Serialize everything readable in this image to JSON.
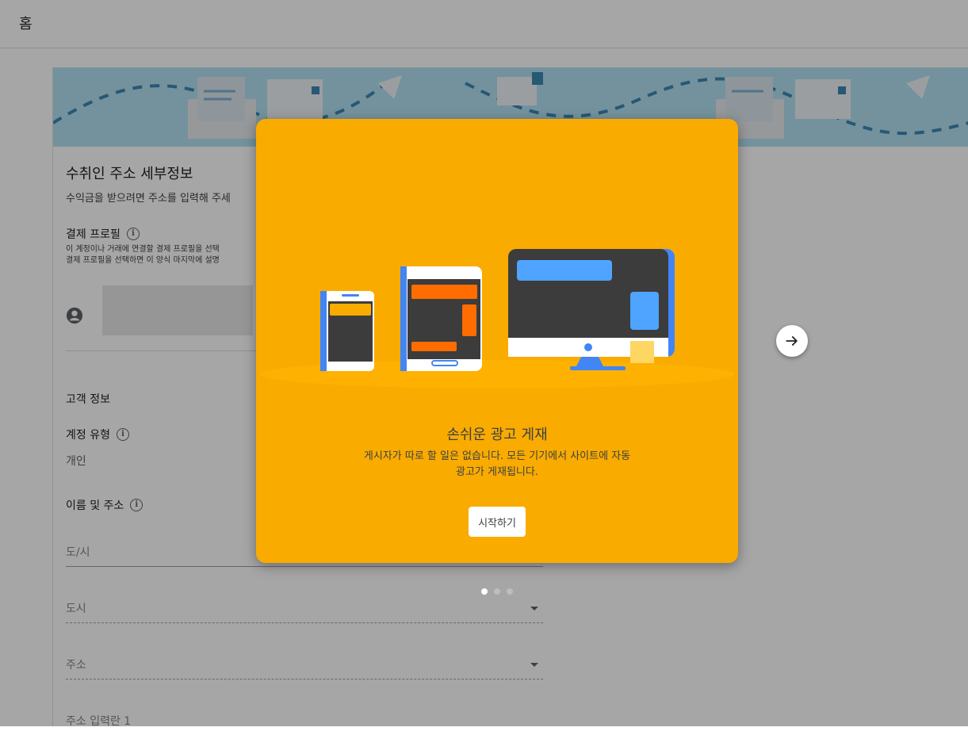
{
  "header": {
    "title": "홈"
  },
  "form": {
    "title": "수취인 주소 세부정보",
    "subtitle": "수익금을 받으려면 주소를 입력해 주세",
    "payment_profile": {
      "label": "결제 프로필",
      "desc_line1": "이 계정이나 거래에 연결할 결제 프로필을 선택",
      "desc_line2": "결제 프로필을 선택하면 이 양식 마지막에 설명"
    },
    "customer_info": {
      "heading": "고객 정보",
      "account_type_label": "계정 유형",
      "account_type_value": "개인",
      "name_address_label": "이름 및 주소"
    },
    "fields": {
      "province": "도/시",
      "city": "도시",
      "address": "주소",
      "address_line1": "주소 입력란 1"
    }
  },
  "modal": {
    "title": "손쉬운 광고 게재",
    "desc_line1": "게시자가 따로 할 일은 없습니다. 모든 기기에서 사이트에 자동",
    "desc_line2": "광고가 게재됩니다.",
    "start_button": "시작하기",
    "bg_color": "#f9ab00"
  },
  "carousel": {
    "total": 3,
    "active_index": 1
  },
  "icons": [
    "info-icon",
    "account-circle-icon",
    "arrow-right-icon",
    "dropdown-caret-icon"
  ]
}
